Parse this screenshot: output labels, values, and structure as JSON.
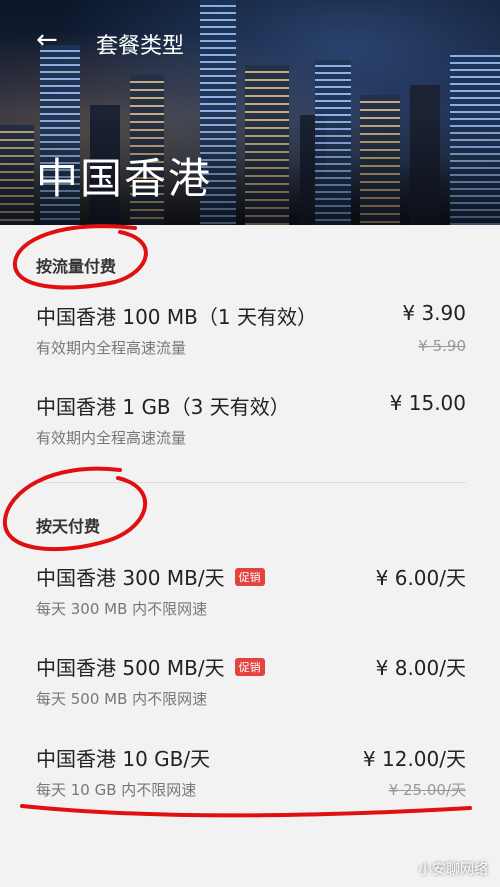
{
  "header": {
    "back_icon": "back-arrow-icon",
    "title": "套餐类型",
    "region": "中国香港"
  },
  "sections": [
    {
      "title": "按流量付费",
      "items": [
        {
          "name": "中国香港 100 MB（1 天有效）",
          "desc": "有效期内全程高速流量",
          "price": "¥ 3.90",
          "old_price": "¥ 5.90"
        },
        {
          "name": "中国香港 1 GB（3 天有效）",
          "desc": "有效期内全程高速流量",
          "price": "¥ 15.00",
          "old_price": ""
        }
      ]
    },
    {
      "title": "按天付费",
      "items": [
        {
          "name": "中国香港 300 MB/天",
          "badge": "促销",
          "desc": "每天 300 MB 内不限网速",
          "price": "¥ 6.00/天",
          "old_price": ""
        },
        {
          "name": "中国香港 500 MB/天",
          "badge": "促销",
          "desc": "每天 500 MB 内不限网速",
          "price": "¥ 8.00/天",
          "old_price": ""
        },
        {
          "name": "中国香港 10 GB/天",
          "desc": "每天 10 GB 内不限网速",
          "price": "¥ 12.00/天",
          "old_price": "¥ 25.00/天"
        }
      ]
    }
  ],
  "watermark": "小安聊网络",
  "colors": {
    "badge": "#e3433e",
    "annotation": "#e01010"
  }
}
